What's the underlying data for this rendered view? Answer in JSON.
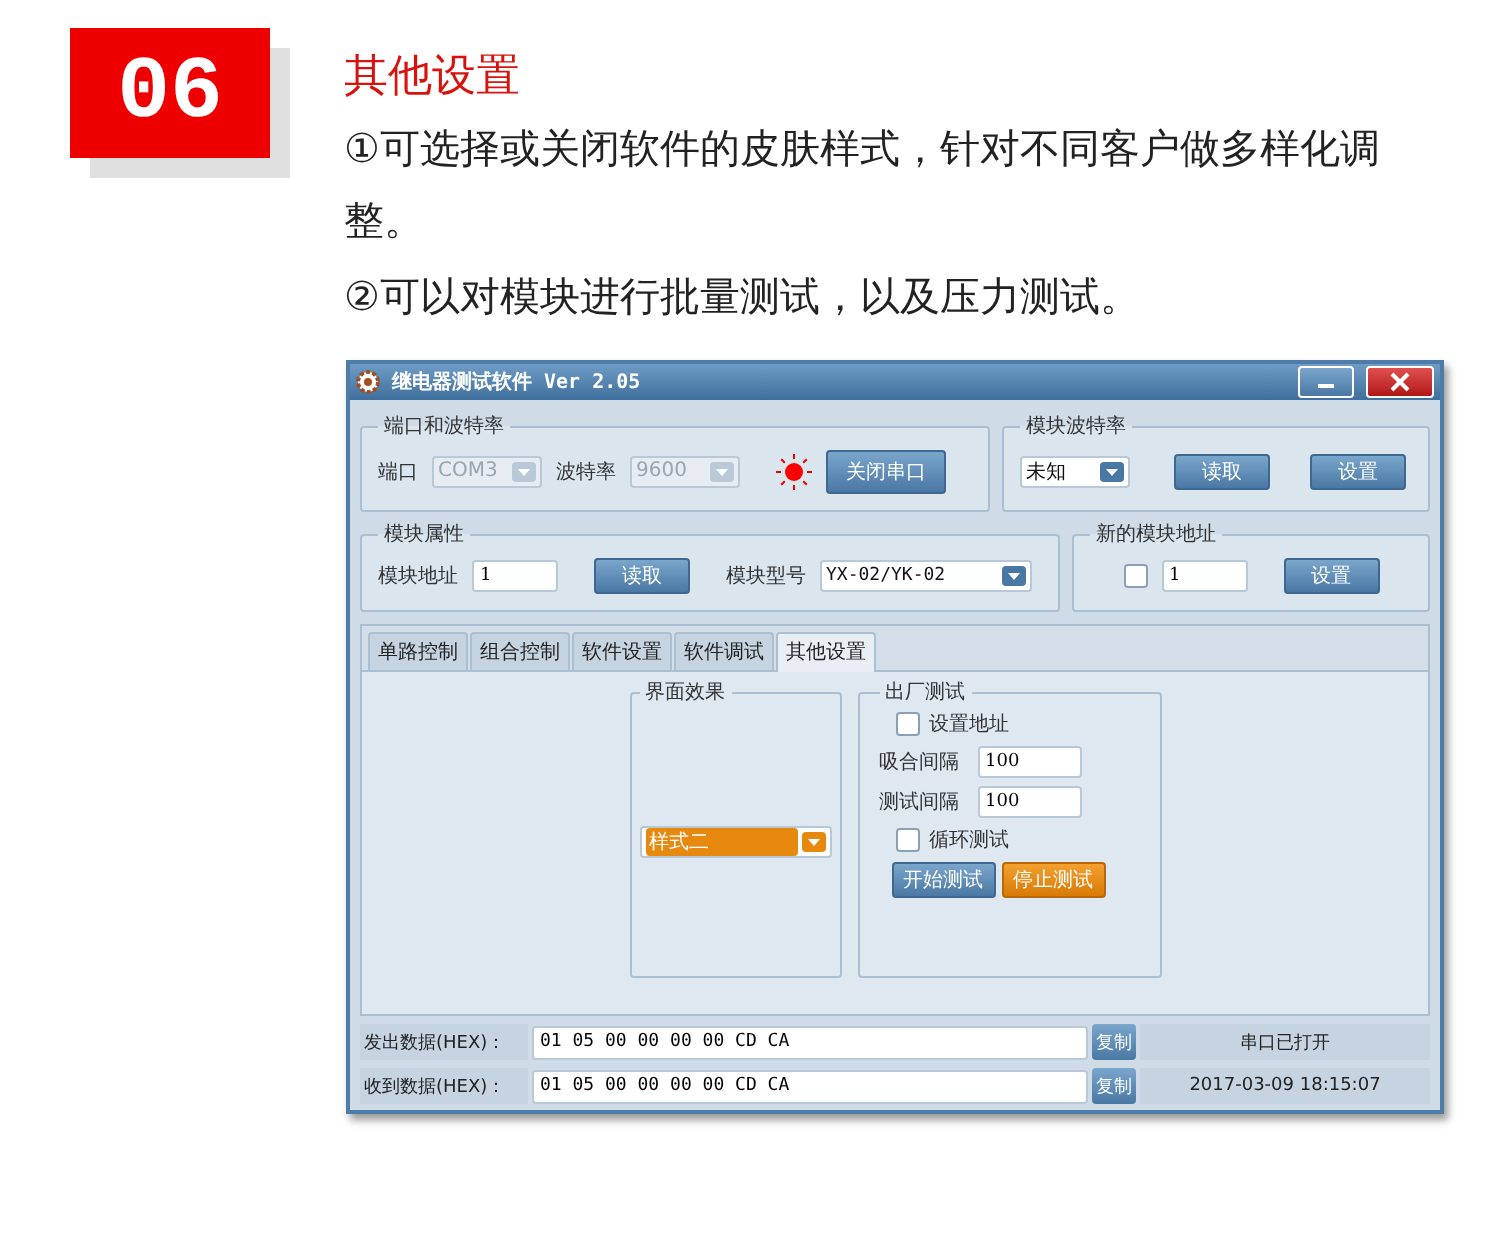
{
  "section": {
    "number": "06",
    "title": "其他设置",
    "lines": [
      "①可选择或关闭软件的皮肤样式，针对不同客户做多样化调整。",
      "②可以对模块进行批量测试，以及压力测试。"
    ]
  },
  "window": {
    "title": "继电器测试软件 Ver 2.05"
  },
  "port_group": {
    "legend": "端口和波特率",
    "port_label": "端口",
    "port_value": "COM3",
    "baud_label": "波特率",
    "baud_value": "9600",
    "disabled": true,
    "led_on": true,
    "button": "关闭串口"
  },
  "module_baud": {
    "legend": "模块波特率",
    "value": "未知",
    "buttons": [
      "读取",
      "设置"
    ]
  },
  "module_props": {
    "legend": "模块属性",
    "addr_label": "模块地址",
    "addr_value": "1",
    "button": "读取",
    "model_label": "模块型号",
    "model_value": "YX-02/YK-02"
  },
  "new_address": {
    "legend": "新的模块地址",
    "checked": false,
    "value": "1",
    "button": "设置"
  },
  "tabs": [
    {
      "label": "单路控制",
      "selected": false
    },
    {
      "label": "组合控制",
      "selected": false
    },
    {
      "label": "软件设置",
      "selected": false
    },
    {
      "label": "软件调试",
      "selected": false
    },
    {
      "label": "其他设置",
      "selected": true
    }
  ],
  "skin": {
    "legend": "界面效果",
    "value": "样式二"
  },
  "factory_test": {
    "legend": "出厂测试",
    "set_address": {
      "label": "设置地址",
      "checked": false
    },
    "fields": [
      {
        "label": "吸合间隔",
        "value": "100"
      },
      {
        "label": "测试间隔",
        "value": "100"
      }
    ],
    "loop": {
      "label": "循环测试",
      "checked": false
    },
    "buttons": [
      {
        "label": "开始测试",
        "kind": "primary"
      },
      {
        "label": "停止测试",
        "kind": "accent"
      }
    ]
  },
  "data_rows": [
    {
      "label": "发出数据(HEX)：",
      "value": "01 05 00 00 00 00 CD CA",
      "copy": "复制",
      "status": "串口已打开"
    },
    {
      "label": "收到数据(HEX)：",
      "value": "01 05 00 00 00 00 CD CA",
      "copy": "复制",
      "status": "2017-03-09 18:15:07"
    }
  ]
}
